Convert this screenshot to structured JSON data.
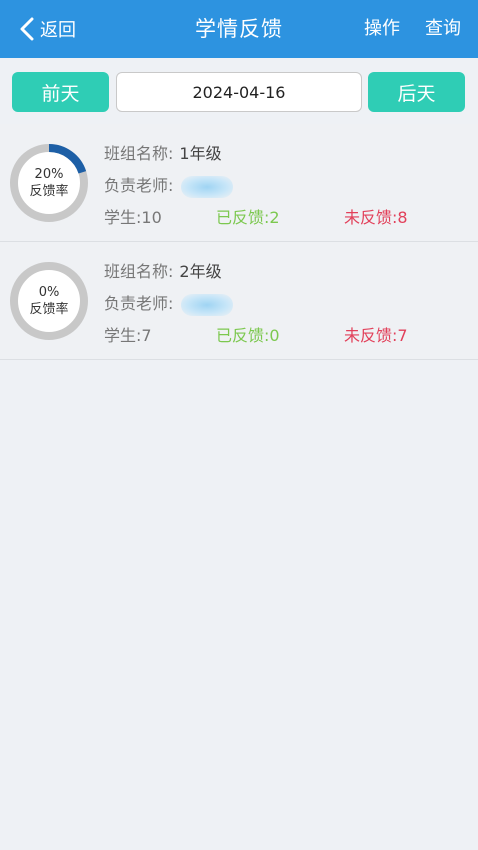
{
  "header": {
    "back_label": "返回",
    "title": "学情反馈",
    "action_operate": "操作",
    "action_query": "查询",
    "bg_color": "#2d93e0"
  },
  "datebar": {
    "prev_label": "前天",
    "date_value": "2024-04-16",
    "next_label": "后天",
    "button_color": "#2fcdb5"
  },
  "classes": [
    {
      "rate_text": "20%",
      "rate_fraction": 0.2,
      "rate_label": "反馈率",
      "name_label": "班组名称:",
      "name_value": "1年级",
      "teacher_label": "负责老师:",
      "students_text": "学生:10",
      "done_text": "已反馈:2",
      "pending_text": "未反馈:8"
    },
    {
      "rate_text": "0%",
      "rate_fraction": 0,
      "rate_label": "反馈率",
      "name_label": "班组名称:",
      "name_value": "2年级",
      "teacher_label": "负责老师:",
      "students_text": "学生:7",
      "done_text": "已反馈:0",
      "pending_text": "未反馈:7"
    }
  ],
  "colors": {
    "ring_track": "#c8c8c8",
    "ring_fill": "#1d5fa6",
    "done": "#7cc84f",
    "pending": "#e2405a"
  },
  "icons": {
    "back": "chevron-left-icon"
  }
}
